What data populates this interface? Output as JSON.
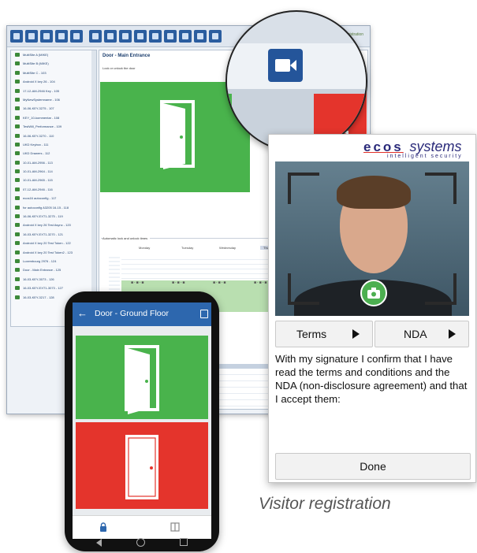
{
  "desktop": {
    "toolbar_brand": "ecos systems visitor registration",
    "panel_title": "Door - Main Entrance",
    "panel_subtitle": "Lock or unlock the door",
    "schedule_title": "Automatic lock and unlock times",
    "days": [
      "Monday",
      "Tuesday",
      "Wednesday",
      "Thursday"
    ],
    "tree_items": [
      "MultiSite A (MIKE)",
      "MultiSite B (MIKE)",
      "MultiSite C - 103",
      "Android X key 26 - 104",
      "17-12-AM-2946 Key - 105",
      "MyNewSystemname - 106",
      "16-06-KEY-3275 - 107",
      "KEY_10-kommentar - 108",
      "TestWill_Performance - 109",
      "16-06-KEY-3270 - 110",
      "UKD Keybox - 111",
      "UKD Drawers - 112",
      "10-01-AM-2956 - 113",
      "10-01-AM-2964 - 114",
      "10-01-AM-2965 - 115",
      "07-12-AM-2946 - 116",
      "ecos16 autoconfig - 117",
      "for autoconfig A3205 16-15 - 118",
      "16-06-KEY-EXT1-3275 - 119",
      "Android X key 26 Test Async - 120",
      "16-03-KEY-EXT1-3270 - 121",
      "Android X key 20 Test Token - 122",
      "Android X key 20 Test Token2 - 123",
      "Luxembourg 2976 - 124",
      "Door - Main Entrance - 125",
      "16-03-KEY-3073 - 126",
      "16-03-KEY-EXT1-3073 - 127",
      "16-03-KEY-3217 - 128"
    ]
  },
  "magnifier": {
    "icon": "video-camera-icon",
    "accent": "#24559a"
  },
  "visitor": {
    "brand_bold": "ecos",
    "brand_italic": "systems",
    "tagline": "intelligent security",
    "terms_label": "Terms",
    "nda_label": "NDA",
    "consent_text": "With my signature I confirm that I have read the terms and conditions and the NDA (non-disclosure agreement) and that I accept them:",
    "done_label": "Done",
    "caption": "Visitor registration"
  },
  "phone": {
    "title": "Door - Ground Floor",
    "back_icon": "←",
    "green": "#49b34c",
    "red": "#e4342c",
    "appbar": "#2d67ae"
  }
}
